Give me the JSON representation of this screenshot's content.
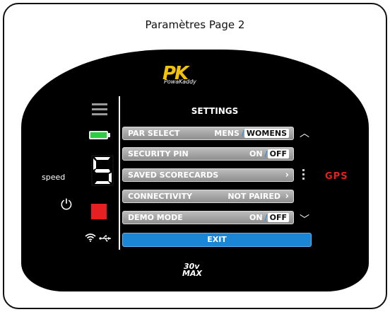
{
  "page": {
    "title": "Paramètres Page 2"
  },
  "brand": {
    "logo": "PK",
    "logo_sub": "PowaKaddy",
    "model_top": "30v",
    "model_bottom": "MAX"
  },
  "left": {
    "speed_label": "speed",
    "speed_value": "5"
  },
  "settings": {
    "title": "SETTINGS",
    "rows": [
      {
        "label": "PAR SELECT",
        "opt1": "MENS",
        "opt2": "WOMENS",
        "selected": "WOMENS"
      },
      {
        "label": "SECURITY PIN",
        "opt1": "ON",
        "opt2": "OFF",
        "selected": "OFF"
      },
      {
        "label": "SAVED SCORECARDS",
        "value": ""
      },
      {
        "label": "CONNECTIVITY",
        "value": "NOT PAIRED"
      },
      {
        "label": "DEMO MODE",
        "opt1": "ON",
        "opt2": "OFF",
        "selected": "OFF"
      }
    ],
    "exit": "EXIT"
  },
  "right": {
    "gps": "GPS"
  },
  "colors": {
    "accent": "#1b86d6",
    "brand_yellow": "#f2c10a",
    "alert_red": "#e52020",
    "battery_green": "#2ecc40"
  },
  "icons": [
    "menu-icon",
    "battery-icon",
    "power-icon",
    "stop-icon",
    "wifi-icon",
    "usb-icon",
    "chevron-up-icon",
    "chevron-down-icon",
    "chevron-right-icon"
  ]
}
